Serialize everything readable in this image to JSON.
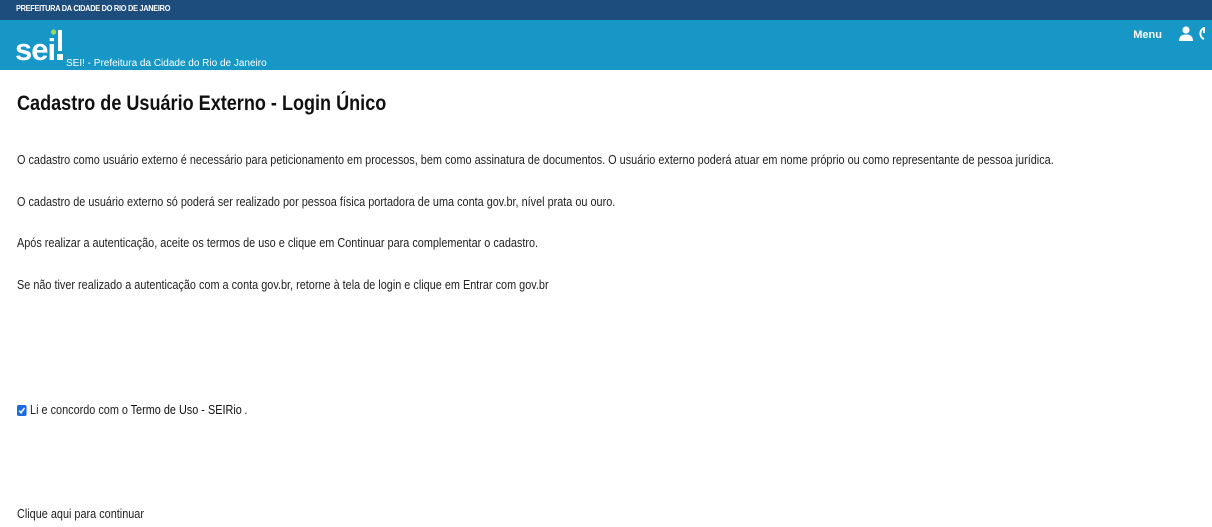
{
  "topbar": {
    "label": "PREFEITURA DA CIDADE DO RIO DE JANEIRO"
  },
  "header": {
    "logo_text": "sei!",
    "subtitle": "SEI! - Prefeitura da Cidade do Rio de Janeiro",
    "menu_label": "Menu",
    "icons": [
      "user-icon",
      "power-icon"
    ]
  },
  "page": {
    "title": "Cadastro de Usuário Externo - Login Único",
    "paragraphs": [
      "O cadastro como usuário externo é necessário para peticionamento em processos, bem como assinatura de documentos. O usuário externo poderá atuar em nome próprio ou como representante de pessoa jurídica.",
      "O cadastro de usuário externo só poderá ser realizado por pessoa física portadora de uma conta gov.br, nível prata ou ouro.",
      "Após realizar a autenticação, aceite os termos de uso e clique em Continuar para complementar o cadastro.",
      "Se não tiver realizado a autenticação com a conta gov.br, retorne à tela de login e clique em Entrar com gov.br"
    ],
    "terms": {
      "checked": true,
      "prefix": "Li e concordo com o",
      "link": "Termo de Uso - SEIRio",
      "suffix": "."
    },
    "continue_link": "Clique aqui para continuar"
  },
  "colors": {
    "topbar": "#1c4d7d",
    "header": "#1797c6",
    "checkbox": "#1e6ae0",
    "logo_accent": "#a4d65e"
  }
}
